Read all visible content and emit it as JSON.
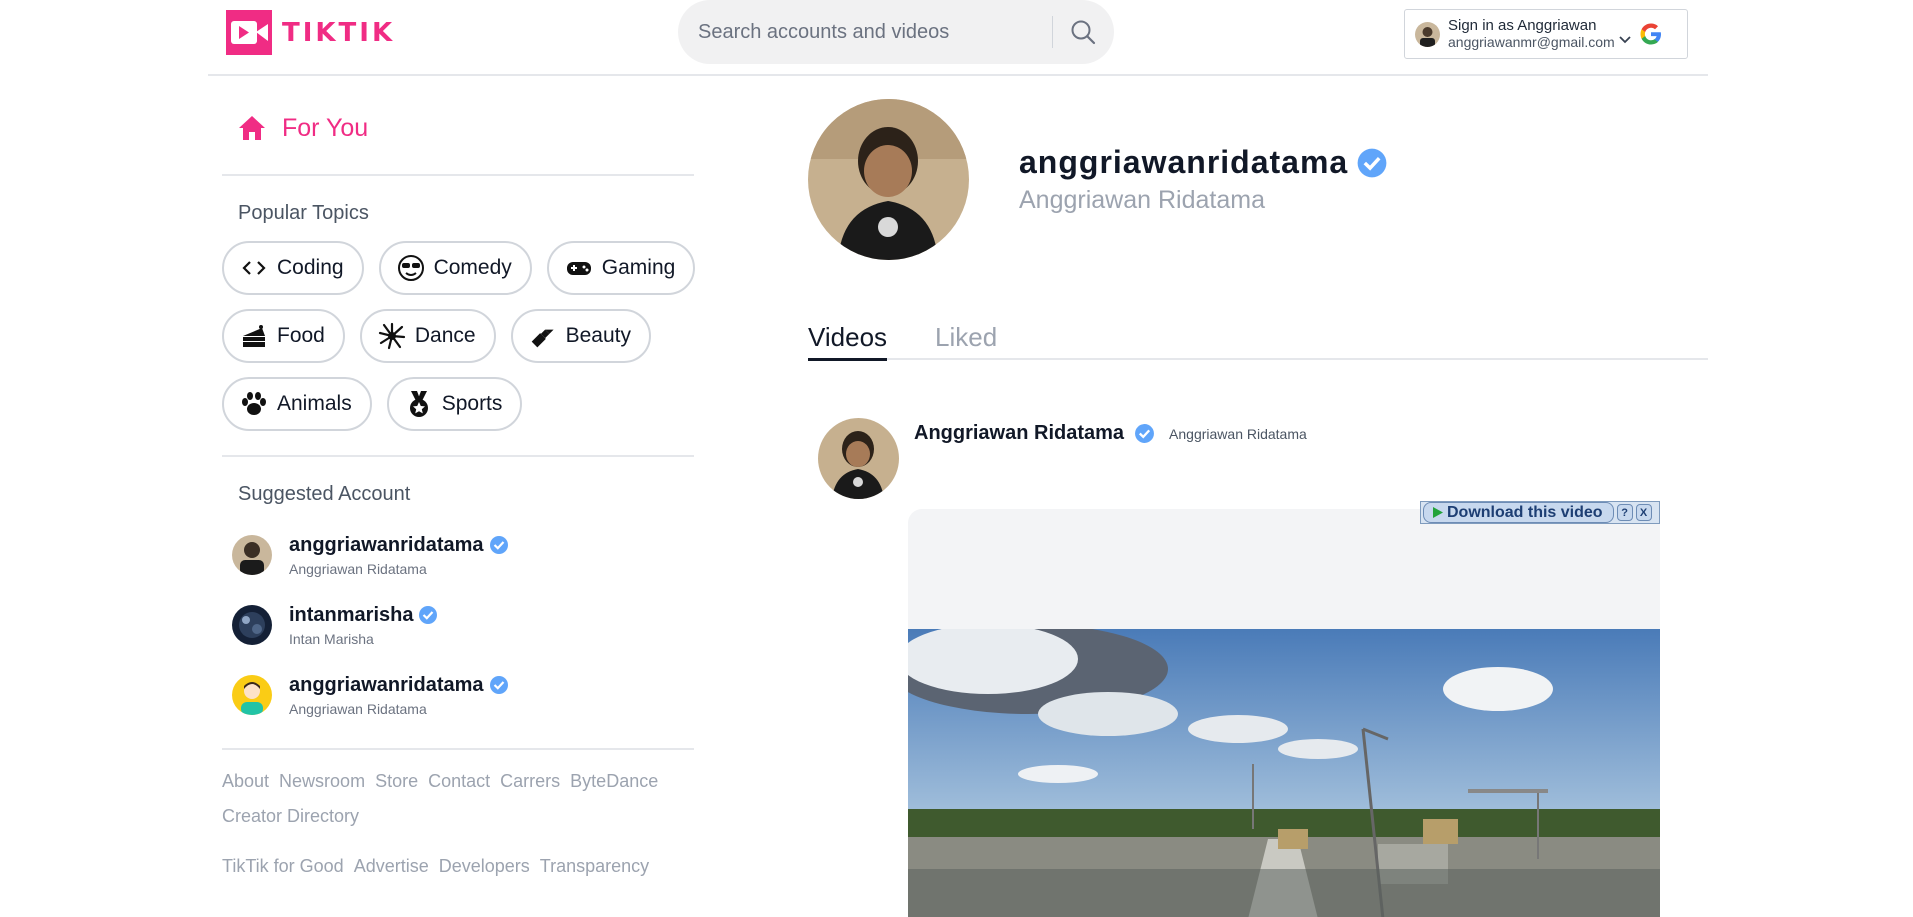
{
  "header": {
    "logo_text": "TIKTIK",
    "search_placeholder": "Search accounts and videos",
    "account": {
      "signin_label": "Sign in as Anggriawan",
      "email": "anggriawanmr@gmail.com"
    }
  },
  "sidebar": {
    "for_you_label": "For You",
    "popular_topics_title": "Popular Topics",
    "topics": [
      {
        "label": "Coding",
        "icon": "code-icon"
      },
      {
        "label": "Comedy",
        "icon": "sunglasses-face-icon"
      },
      {
        "label": "Gaming",
        "icon": "gamepad-icon"
      },
      {
        "label": "Food",
        "icon": "cake-icon"
      },
      {
        "label": "Dance",
        "icon": "dance-burst-icon"
      },
      {
        "label": "Beauty",
        "icon": "lipstick-icon"
      },
      {
        "label": "Animals",
        "icon": "paw-icon"
      },
      {
        "label": "Sports",
        "icon": "medal-icon"
      }
    ],
    "suggested_title": "Suggested Account",
    "suggested": [
      {
        "handle": "anggriawanridatama",
        "name": "Anggriawan Ridatama"
      },
      {
        "handle": "intanmarisha",
        "name": "Intan Marisha"
      },
      {
        "handle": "anggriawanridatama",
        "name": "Anggriawan Ridatama"
      }
    ],
    "footer_links_1": [
      "About",
      "Newsroom",
      "Store",
      "Contact",
      "Carrers",
      "ByteDance",
      "Creator Directory"
    ],
    "footer_links_2": [
      "TikTik for Good",
      "Advertise",
      "Developers",
      "Transparency"
    ]
  },
  "profile": {
    "handle": "anggriawanridatama",
    "name": "Anggriawan Ridatama"
  },
  "tabs": {
    "videos": "Videos",
    "liked": "Liked"
  },
  "post": {
    "author": "Anggriawan Ridatama",
    "author_sub": "Anggriawan Ridatama",
    "download_label": "Download this video",
    "help_label": "?",
    "close_label": "X"
  },
  "colors": {
    "brand": "#f02c84",
    "verified": "#60a5fa",
    "muted": "#9ca3af"
  }
}
